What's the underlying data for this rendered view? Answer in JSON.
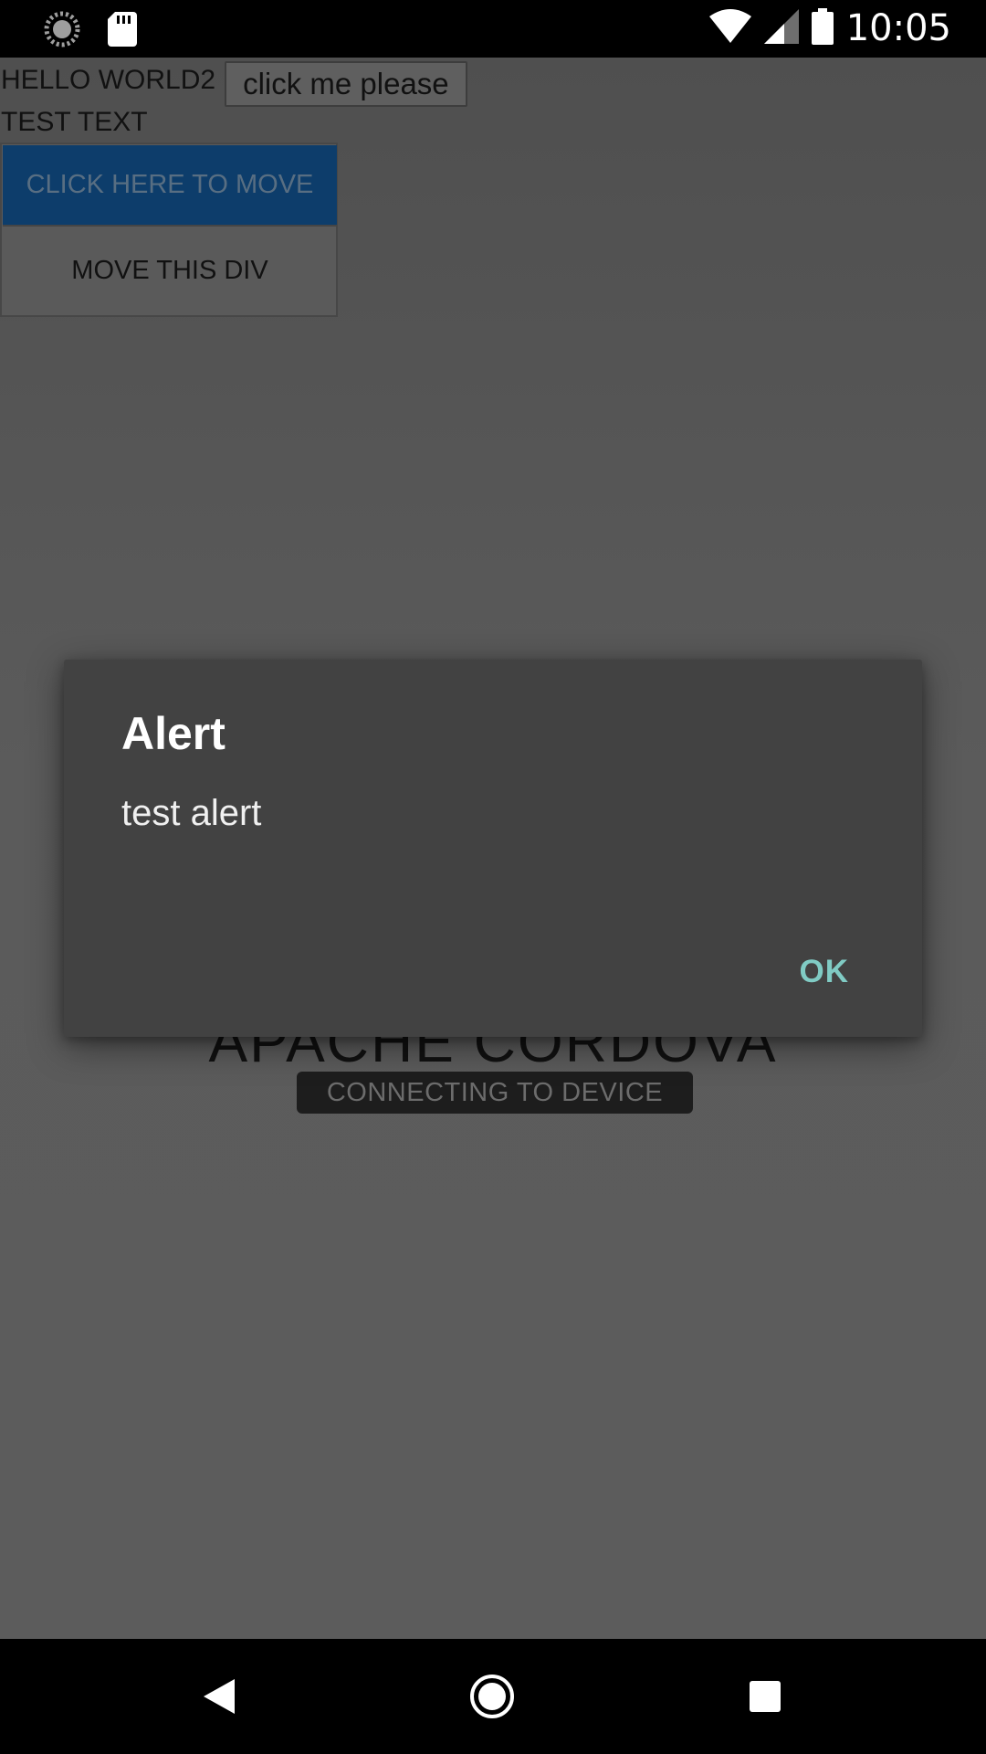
{
  "status_bar": {
    "time": "10:05",
    "icons": [
      "loading-icon",
      "sd-card-icon",
      "wifi-icon",
      "cellular-signal-icon",
      "battery-icon"
    ]
  },
  "app": {
    "hello_text": "HELLO WORLD2",
    "click_button_label": "click me please",
    "test_text": "TEST TEXT",
    "move_button_label": "CLICK HERE TO MOVE",
    "move_div_label": "MOVE THIS DIV",
    "cordova_title": "APACHE CORDOVA",
    "cordova_status": "CONNECTING TO DEVICE"
  },
  "dialog": {
    "title": "Alert",
    "message": "test alert",
    "ok_label": "OK",
    "accent_color": "#80cbc4"
  },
  "nav_bar": {
    "buttons": [
      "back-icon",
      "home-icon",
      "recents-icon"
    ]
  }
}
